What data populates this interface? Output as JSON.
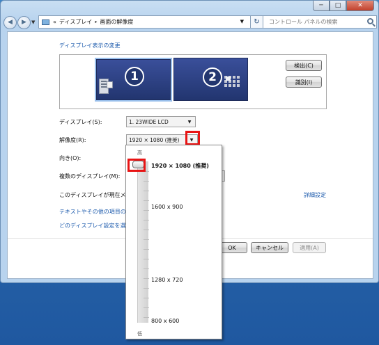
{
  "window": {
    "controls": {
      "minimize": "─",
      "maximize": "□",
      "close": "✕"
    }
  },
  "nav": {
    "back": "◀",
    "forward": "▶",
    "history": "▼",
    "breadcrumb": [
      "«",
      "ディスプレイ",
      "画面の解像度"
    ],
    "breadcrumb_sep": "▸",
    "address_drop": "▼",
    "refresh": "↻",
    "search_placeholder": "コントロール パネルの検索"
  },
  "main": {
    "title": "ディスプレイ表示の変更",
    "monitors": [
      {
        "number": "1"
      },
      {
        "number": "2"
      }
    ],
    "detect_button": "検出(C)",
    "identify_button": "識別(I)",
    "display_label": "ディスプレイ(S):",
    "display_value": "1. 23WIDE LCD",
    "resolution_label": "解像度(R):",
    "resolution_value": "1920 × 1080 (推奨)",
    "orientation_label": "向き(O):",
    "multi_label": "複数のディスプレイ(M):",
    "current_text": "このディスプレイが現在メ",
    "advanced_link": "詳細設定",
    "text_size_link": "テキストやその他の項目の",
    "which_setting_link": "どのディスプレイ設定を選",
    "ok_button": "OK",
    "cancel_button": "キャンセル",
    "apply_button": "適用(A)"
  },
  "resolution_popup": {
    "high_label": "高",
    "low_label": "低",
    "options": [
      "1920 × 1080 (推奨)",
      "1600 x 900",
      "1280 x 720",
      "800 x 600"
    ],
    "selected": "1920 × 1080 (推奨)"
  },
  "colors": {
    "link": "#1d5bad",
    "highlight": "#e81414",
    "monitor_bg": "#23366f"
  },
  "icons": {
    "drop": "▼"
  }
}
